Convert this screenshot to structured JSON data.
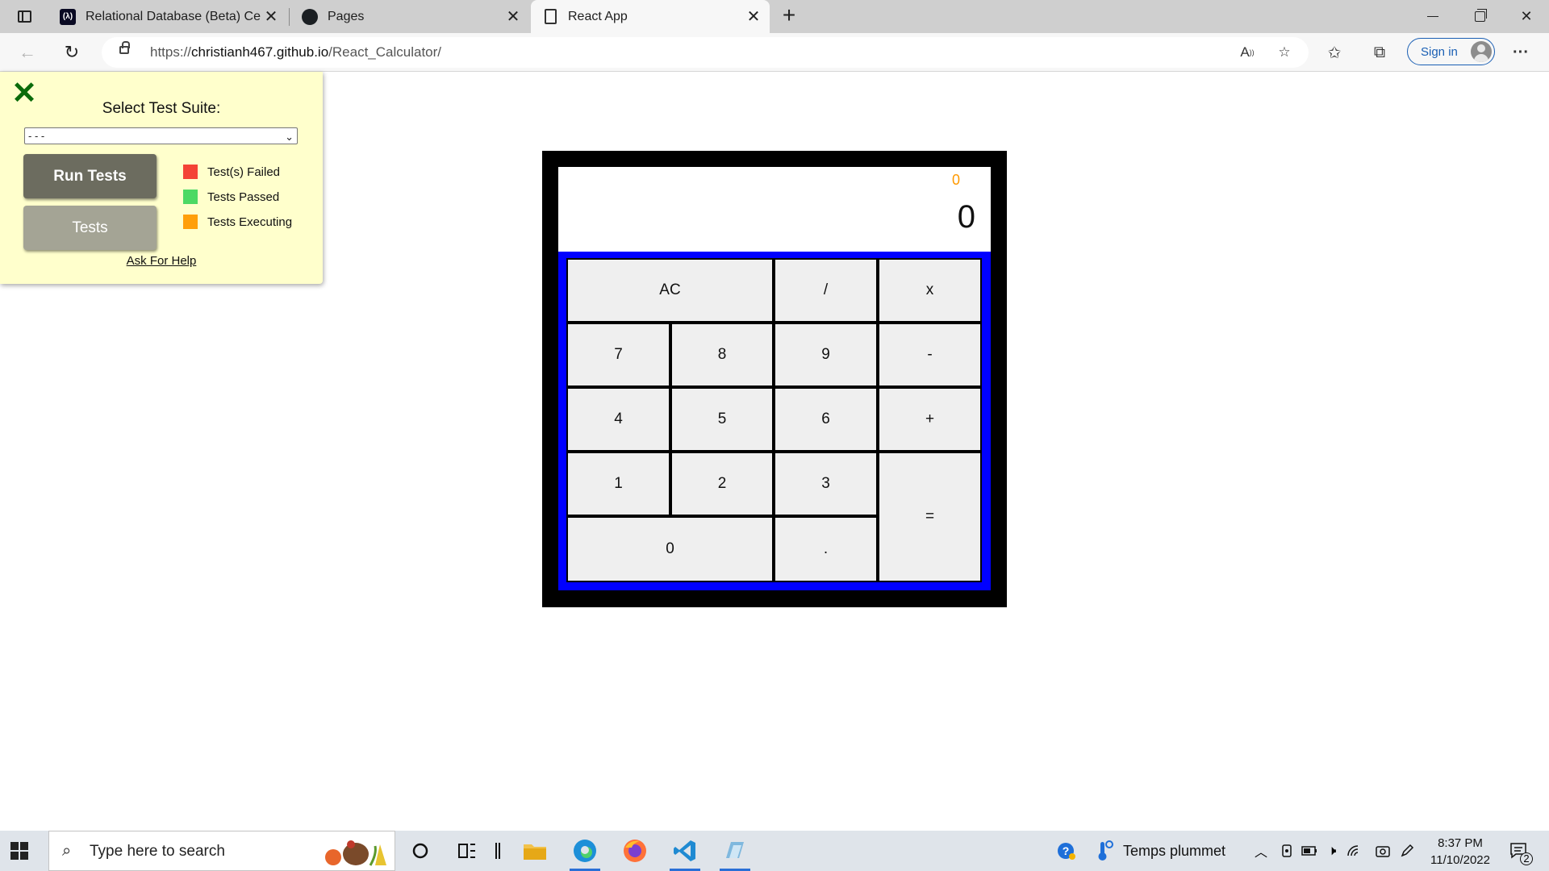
{
  "browser": {
    "tabs": [
      {
        "title": "Relational Database (Beta) Certifi",
        "icon": "freecodecamp-icon",
        "active": false
      },
      {
        "title": "Pages",
        "icon": "github-icon",
        "active": false
      },
      {
        "title": "React App",
        "icon": "page-icon",
        "active": true
      }
    ],
    "new_tab_glyph": "+",
    "url": {
      "prefix": "https://",
      "host": "christianh467.github.io",
      "path": "/React_Calculator/"
    },
    "sign_in_label": "Sign in",
    "more_glyph": "···"
  },
  "test_panel": {
    "close_glyph": "✕",
    "title": "Select Test Suite:",
    "selected_suite": "- - -",
    "run_tests_label": "Run Tests",
    "tests_label": "Tests",
    "legend": [
      {
        "label": "Test(s) Failed",
        "color": "#f44336"
      },
      {
        "label": "Tests Passed",
        "color": "#4cd964"
      },
      {
        "label": "Tests Executing",
        "color": "#ff9f0a"
      }
    ],
    "help_link": "Ask For Help"
  },
  "calculator": {
    "formula": "0",
    "output": "0",
    "keys": [
      "AC",
      "/",
      "x",
      "7",
      "8",
      "9",
      "-",
      "4",
      "5",
      "6",
      "+",
      "1",
      "2",
      "3",
      "=",
      "0",
      "."
    ],
    "colors": {
      "frame": "#000000",
      "keypad_bg": "#0000ff",
      "key_bg": "#efefef",
      "formula": "#ff9900"
    }
  },
  "taskbar": {
    "search_placeholder": "Type here to search",
    "weather_text": "Temps plummet",
    "time": "8:37 PM",
    "date": "11/10/2022",
    "notification_count": "2"
  }
}
